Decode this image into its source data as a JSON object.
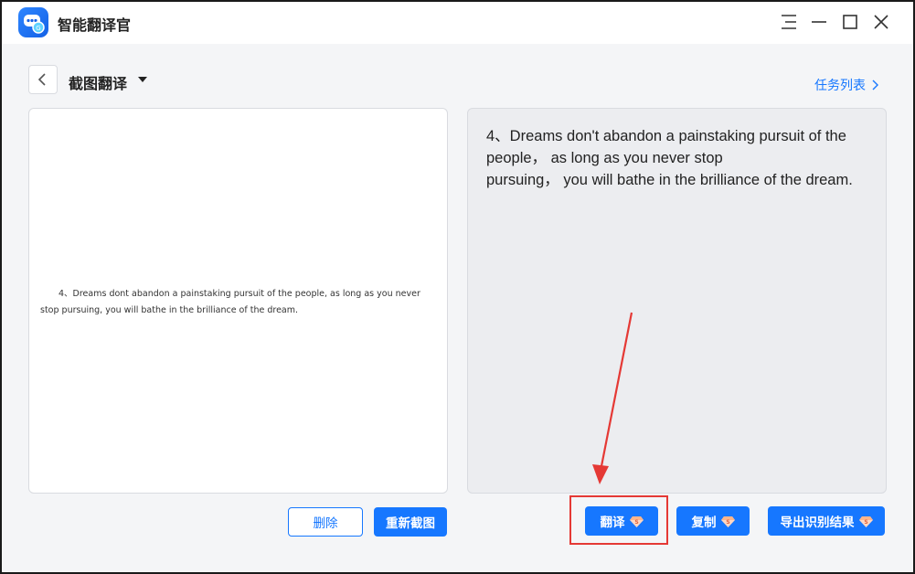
{
  "app": {
    "title": "智能翻译官",
    "accent": "#1677ff"
  },
  "header": {
    "mode_title": "截图翻译",
    "task_list_label": "任务列表"
  },
  "source": {
    "text": "4、Dreams dont abandon a painstaking pursuit of the people, as long as you never stop pursuing, you will bathe in the brilliance of the dream."
  },
  "result": {
    "text": "4、Dreams don't abandon a painstaking pursuit of the people， as long as you never stop\npursuing， you will bathe in the brilliance of the dream."
  },
  "buttons": {
    "delete": "删除",
    "recapture": "重新截图",
    "translate": "翻译",
    "copy": "复制",
    "export": "导出识别结果"
  },
  "icons": {
    "app_logo": "chat-bubble-logo-icon",
    "menu": "menu-icon",
    "minimize": "minimize-icon",
    "maximize": "maximize-icon",
    "close": "close-icon",
    "back": "chevron-left-icon",
    "caret": "caret-down-icon",
    "task_arrow": "chevron-right-icon",
    "vip": "vip-gem-icon"
  },
  "annotation": {
    "highlight_color": "#e53935"
  }
}
